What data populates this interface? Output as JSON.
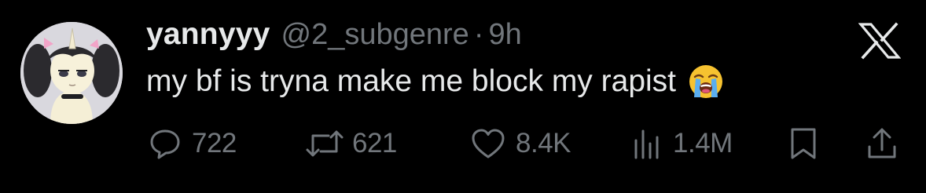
{
  "tweet": {
    "display_name": "yannyyy",
    "handle": "@2_subgenre",
    "separator": "·",
    "time": "9h",
    "text": "my bf is tryna make me block my rapist",
    "emoji": "loudly-crying-face"
  },
  "actions": {
    "replies": "722",
    "reposts": "621",
    "likes": "8.4K",
    "views": "1.4M"
  },
  "icons": {
    "brand": "x-logo",
    "reply": "speech-bubble-icon",
    "repost": "repost-icon",
    "like": "heart-icon",
    "views": "bar-chart-icon",
    "bookmark": "bookmark-icon",
    "share": "share-icon"
  },
  "colors": {
    "background": "#000000",
    "text_primary": "#e7e9ea",
    "text_secondary": "#71767b"
  }
}
